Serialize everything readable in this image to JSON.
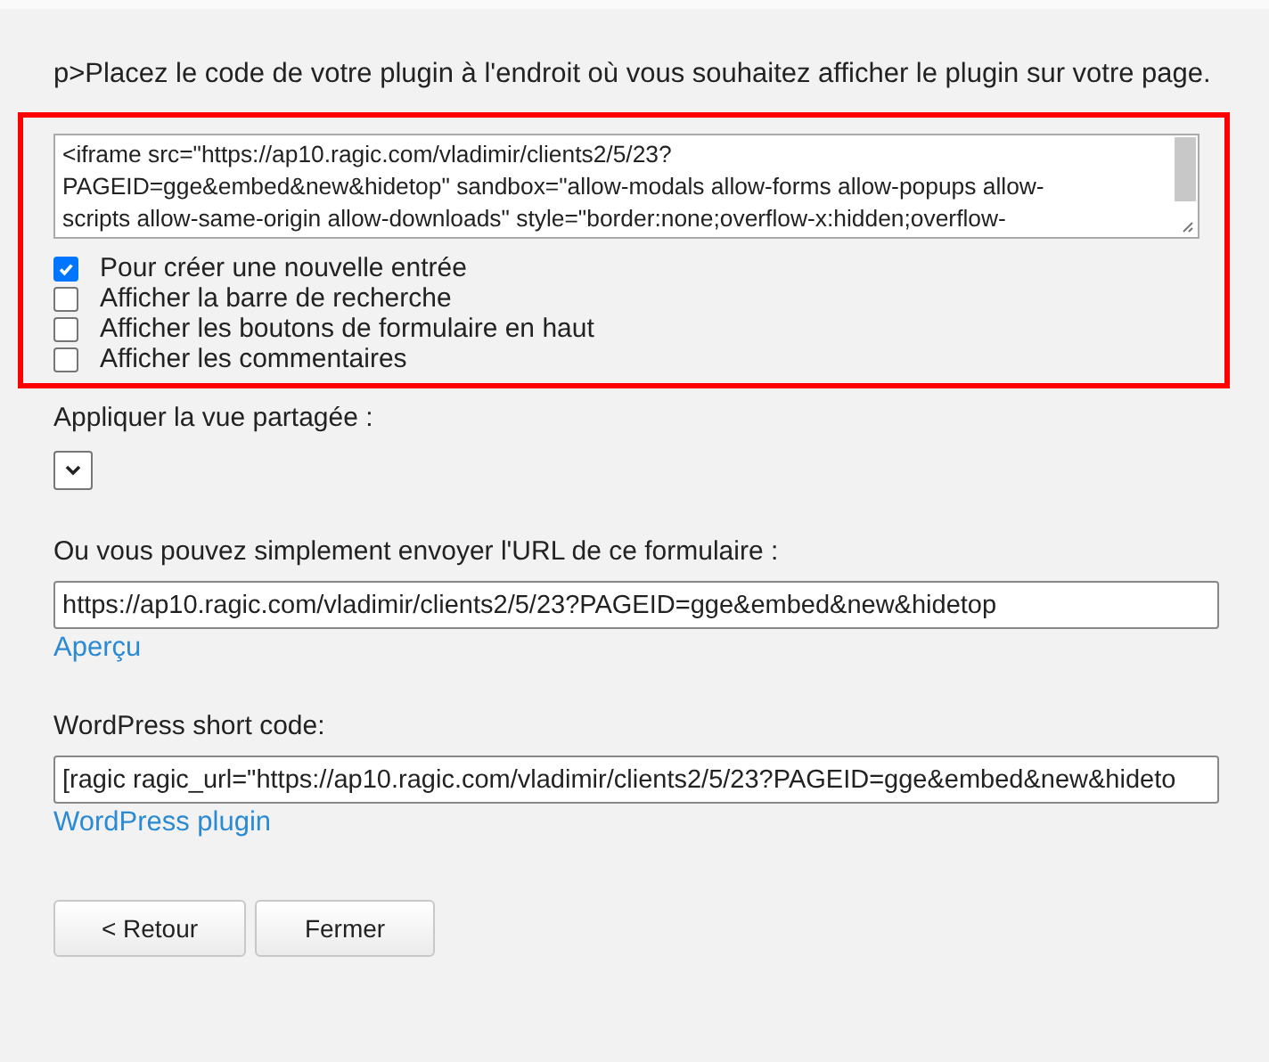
{
  "intro": "p>Placez le code de votre plugin à l'endroit où vous souhaitez afficher le plugin sur votre page.",
  "embed_code": {
    "lines": [
      "<iframe src=\"https://ap10.ragic.com/vladimir/clients2/5/23?",
      "PAGEID=gge&embed&new&hidetop\" sandbox=\"allow-modals allow-forms allow-popups allow-",
      "scripts allow-same-origin allow-downloads\" style=\"border:none;overflow-x:hidden;overflow-"
    ]
  },
  "options": [
    {
      "label": "Pour créer une nouvelle entrée",
      "checked": true
    },
    {
      "label": "Afficher la barre de recherche",
      "checked": false
    },
    {
      "label": "Afficher les boutons de formulaire en haut",
      "checked": false
    },
    {
      "label": "Afficher les commentaires",
      "checked": false
    }
  ],
  "shared_view": {
    "label": "Appliquer la vue partagée :"
  },
  "url_section": {
    "label": "Ou vous pouvez simplement envoyer l'URL de ce formulaire :",
    "value": "https://ap10.ragic.com/vladimir/clients2/5/23?PAGEID=gge&embed&new&hidetop",
    "link": "Aperçu"
  },
  "wordpress": {
    "label": "WordPress short code:",
    "value": "[ragic ragic_url=\"https://ap10.ragic.com/vladimir/clients2/5/23?PAGEID=gge&embed&new&hideto",
    "link": "WordPress plugin"
  },
  "buttons": [
    "< Retour",
    "Fermer"
  ]
}
